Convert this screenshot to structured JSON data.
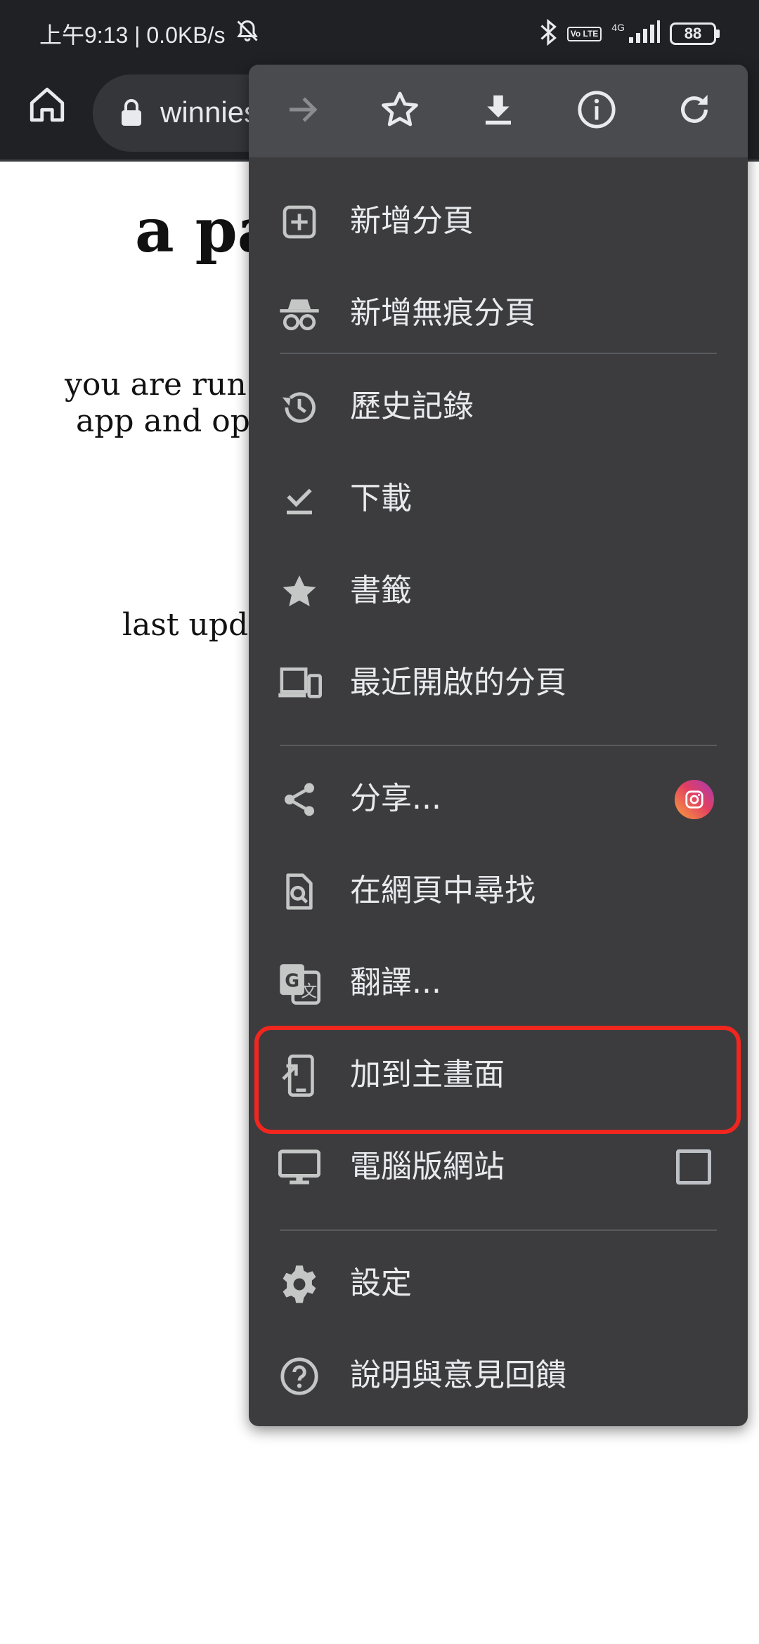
{
  "status_bar": {
    "left_text": "上午9:13 | 0.0KB/s",
    "volte": "Vo LTE",
    "network": "4G",
    "battery": "88",
    "icons": [
      "mute-bell-icon",
      "bluetooth-icon",
      "signal-icon",
      "battery-icon"
    ]
  },
  "toolbar": {
    "url": "winnies",
    "icons": [
      "home-icon",
      "lock-icon"
    ]
  },
  "page": {
    "title": "a pa",
    "line1": "you are run",
    "line2": "app and ope",
    "line3": "last upda"
  },
  "menu": {
    "action_icons": [
      "forward-icon",
      "bookmark-star-icon",
      "download-icon",
      "info-icon",
      "refresh-icon"
    ],
    "items": [
      {
        "label": "新增分頁",
        "icon": "new-tab-icon"
      },
      {
        "label": "新增無痕分頁",
        "icon": "incognito-icon"
      },
      {
        "label": "歷史記錄",
        "icon": "history-icon"
      },
      {
        "label": "下載",
        "icon": "downloads-icon"
      },
      {
        "label": "書籤",
        "icon": "bookmarks-icon"
      },
      {
        "label": "最近開啟的分頁",
        "icon": "recent-tabs-icon"
      },
      {
        "label": "分享...",
        "icon": "share-icon"
      },
      {
        "label": "在網頁中尋找",
        "icon": "find-in-page-icon"
      },
      {
        "label": "翻譯...",
        "icon": "translate-icon"
      },
      {
        "label": "加到主畫面",
        "icon": "add-to-home-icon",
        "highlighted": true
      },
      {
        "label": "電腦版網站",
        "icon": "desktop-site-icon",
        "checkbox_checked": false
      },
      {
        "label": "設定",
        "icon": "settings-icon"
      },
      {
        "label": "說明與意見回饋",
        "icon": "help-icon"
      }
    ]
  },
  "colors": {
    "menu_bg": "#3c3c3f",
    "menu_header_bg": "#4a4b4f",
    "toolbar_bg": "#202124",
    "text": "#e8eaed",
    "highlight": "#f0261f"
  }
}
